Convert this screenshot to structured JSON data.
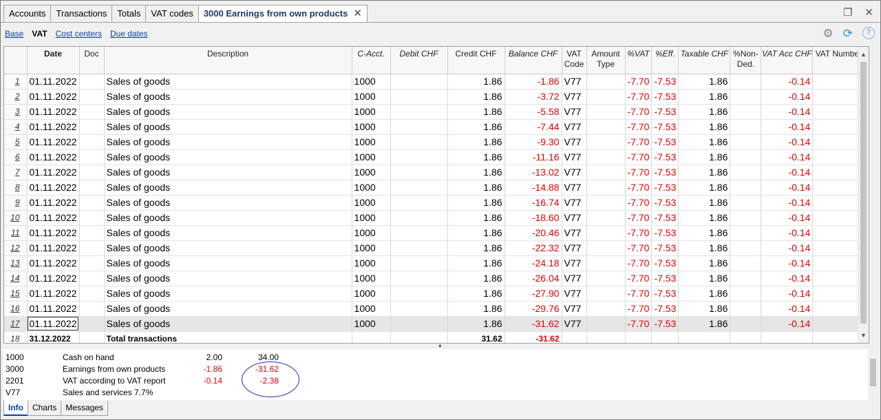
{
  "tabs": [
    {
      "label": "Accounts"
    },
    {
      "label": "Transactions"
    },
    {
      "label": "Totals"
    },
    {
      "label": "VAT codes"
    },
    {
      "label": "3000 Earnings from own products"
    }
  ],
  "tab_close": "✕",
  "views": {
    "base": "Base",
    "vat": "VAT",
    "cost_centers": "Cost centers",
    "due_dates": "Due dates"
  },
  "columns": {
    "date": "Date",
    "doc": "Doc",
    "description": "Description",
    "cacct": "C-Acct.",
    "debit": "Debit CHF",
    "credit": "Credit CHF",
    "balance": "Balance CHF",
    "vatcode": "VAT Code",
    "amount_type": "Amount Type",
    "pvat": "%VAT",
    "peff": "%Eff.",
    "taxable": "Taxable CHF",
    "pnonded": "%Non-Ded.",
    "vatacc": "VAT Acc CHF",
    "vatnum": "VAT Number"
  },
  "rows": [
    {
      "n": "1",
      "date": "01.11.2022",
      "desc": "Sales of goods",
      "cacct": "1000",
      "credit": "1.86",
      "balance": "-1.86",
      "vatcode": "V77",
      "pvat": "-7.70",
      "peff": "-7.53",
      "taxable": "1.86",
      "vatacc": "-0.14"
    },
    {
      "n": "2",
      "date": "01.11.2022",
      "desc": "Sales of goods",
      "cacct": "1000",
      "credit": "1.86",
      "balance": "-3.72",
      "vatcode": "V77",
      "pvat": "-7.70",
      "peff": "-7.53",
      "taxable": "1.86",
      "vatacc": "-0.14"
    },
    {
      "n": "3",
      "date": "01.11.2022",
      "desc": "Sales of goods",
      "cacct": "1000",
      "credit": "1.86",
      "balance": "-5.58",
      "vatcode": "V77",
      "pvat": "-7.70",
      "peff": "-7.53",
      "taxable": "1.86",
      "vatacc": "-0.14"
    },
    {
      "n": "4",
      "date": "01.11.2022",
      "desc": "Sales of goods",
      "cacct": "1000",
      "credit": "1.86",
      "balance": "-7.44",
      "vatcode": "V77",
      "pvat": "-7.70",
      "peff": "-7.53",
      "taxable": "1.86",
      "vatacc": "-0.14"
    },
    {
      "n": "5",
      "date": "01.11.2022",
      "desc": "Sales of goods",
      "cacct": "1000",
      "credit": "1.86",
      "balance": "-9.30",
      "vatcode": "V77",
      "pvat": "-7.70",
      "peff": "-7.53",
      "taxable": "1.86",
      "vatacc": "-0.14"
    },
    {
      "n": "6",
      "date": "01.11.2022",
      "desc": "Sales of goods",
      "cacct": "1000",
      "credit": "1.86",
      "balance": "-11.16",
      "vatcode": "V77",
      "pvat": "-7.70",
      "peff": "-7.53",
      "taxable": "1.86",
      "vatacc": "-0.14"
    },
    {
      "n": "7",
      "date": "01.11.2022",
      "desc": "Sales of goods",
      "cacct": "1000",
      "credit": "1.86",
      "balance": "-13.02",
      "vatcode": "V77",
      "pvat": "-7.70",
      "peff": "-7.53",
      "taxable": "1.86",
      "vatacc": "-0.14"
    },
    {
      "n": "8",
      "date": "01.11.2022",
      "desc": "Sales of goods",
      "cacct": "1000",
      "credit": "1.86",
      "balance": "-14.88",
      "vatcode": "V77",
      "pvat": "-7.70",
      "peff": "-7.53",
      "taxable": "1.86",
      "vatacc": "-0.14"
    },
    {
      "n": "9",
      "date": "01.11.2022",
      "desc": "Sales of goods",
      "cacct": "1000",
      "credit": "1.86",
      "balance": "-16.74",
      "vatcode": "V77",
      "pvat": "-7.70",
      "peff": "-7.53",
      "taxable": "1.86",
      "vatacc": "-0.14"
    },
    {
      "n": "10",
      "date": "01.11.2022",
      "desc": "Sales of goods",
      "cacct": "1000",
      "credit": "1.86",
      "balance": "-18.60",
      "vatcode": "V77",
      "pvat": "-7.70",
      "peff": "-7.53",
      "taxable": "1.86",
      "vatacc": "-0.14"
    },
    {
      "n": "11",
      "date": "01.11.2022",
      "desc": "Sales of goods",
      "cacct": "1000",
      "credit": "1.86",
      "balance": "-20.46",
      "vatcode": "V77",
      "pvat": "-7.70",
      "peff": "-7.53",
      "taxable": "1.86",
      "vatacc": "-0.14"
    },
    {
      "n": "12",
      "date": "01.11.2022",
      "desc": "Sales of goods",
      "cacct": "1000",
      "credit": "1.86",
      "balance": "-22.32",
      "vatcode": "V77",
      "pvat": "-7.70",
      "peff": "-7.53",
      "taxable": "1.86",
      "vatacc": "-0.14"
    },
    {
      "n": "13",
      "date": "01.11.2022",
      "desc": "Sales of goods",
      "cacct": "1000",
      "credit": "1.86",
      "balance": "-24.18",
      "vatcode": "V77",
      "pvat": "-7.70",
      "peff": "-7.53",
      "taxable": "1.86",
      "vatacc": "-0.14"
    },
    {
      "n": "14",
      "date": "01.11.2022",
      "desc": "Sales of goods",
      "cacct": "1000",
      "credit": "1.86",
      "balance": "-26.04",
      "vatcode": "V77",
      "pvat": "-7.70",
      "peff": "-7.53",
      "taxable": "1.86",
      "vatacc": "-0.14"
    },
    {
      "n": "15",
      "date": "01.11.2022",
      "desc": "Sales of goods",
      "cacct": "1000",
      "credit": "1.86",
      "balance": "-27.90",
      "vatcode": "V77",
      "pvat": "-7.70",
      "peff": "-7.53",
      "taxable": "1.86",
      "vatacc": "-0.14"
    },
    {
      "n": "16",
      "date": "01.11.2022",
      "desc": "Sales of goods",
      "cacct": "1000",
      "credit": "1.86",
      "balance": "-29.76",
      "vatcode": "V77",
      "pvat": "-7.70",
      "peff": "-7.53",
      "taxable": "1.86",
      "vatacc": "-0.14"
    },
    {
      "n": "17",
      "date": "01.11.2022",
      "desc": "Sales of goods",
      "cacct": "1000",
      "credit": "1.86",
      "balance": "-31.62",
      "vatcode": "V77",
      "pvat": "-7.70",
      "peff": "-7.53",
      "taxable": "1.86",
      "vatacc": "-0.14"
    }
  ],
  "total_row": {
    "n": "18",
    "date": "31.12.2022",
    "desc": "Total transactions",
    "credit": "31.62",
    "balance": "-31.62"
  },
  "info": [
    {
      "code": "1000",
      "label": "Cash on hand",
      "v1": "2.00",
      "v2": "34.00"
    },
    {
      "code": "3000",
      "label": "Earnings from own products",
      "v1": "-1.86",
      "v2": "-31.62"
    },
    {
      "code": "2201",
      "label": "VAT according to VAT report",
      "v1": "-0.14",
      "v2": "-2.38"
    },
    {
      "code": "V77",
      "label": "Sales and services 7.7%",
      "v1": "",
      "v2": ""
    }
  ],
  "bottom_tabs": [
    {
      "label": "Info"
    },
    {
      "label": "Charts"
    },
    {
      "label": "Messages"
    }
  ],
  "colors": {
    "negative": "#e00000",
    "link": "#0b3fa8",
    "annotation": "#1a2fc0"
  }
}
